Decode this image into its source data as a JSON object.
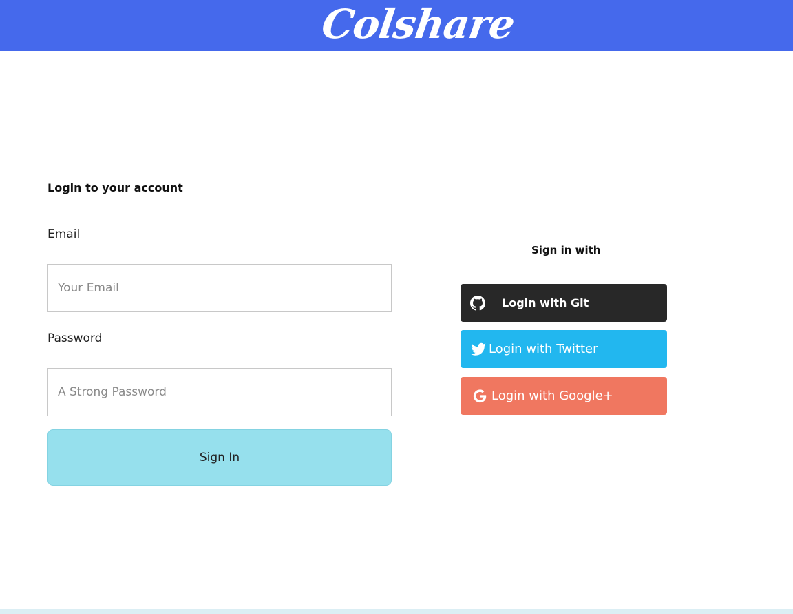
{
  "header": {
    "brand": "Colshare",
    "background_color": "#4569ec"
  },
  "login_form": {
    "title": "Login to your account",
    "email": {
      "label": "Email",
      "value": "",
      "placeholder": "Your Email"
    },
    "password": {
      "label": "Password",
      "value": "",
      "placeholder": "A Strong Password"
    },
    "submit_label": "Sign In",
    "submit_color": "#96e0ed"
  },
  "social_login": {
    "heading": "Sign in with",
    "buttons": [
      {
        "label": "Login with Git",
        "icon": "github-icon",
        "color": "#282828"
      },
      {
        "label": "Login with Twitter",
        "icon": "twitter-icon",
        "color": "#22b7ef"
      },
      {
        "label": "Login with Google+",
        "icon": "google-icon",
        "color": "#f07760"
      }
    ]
  }
}
